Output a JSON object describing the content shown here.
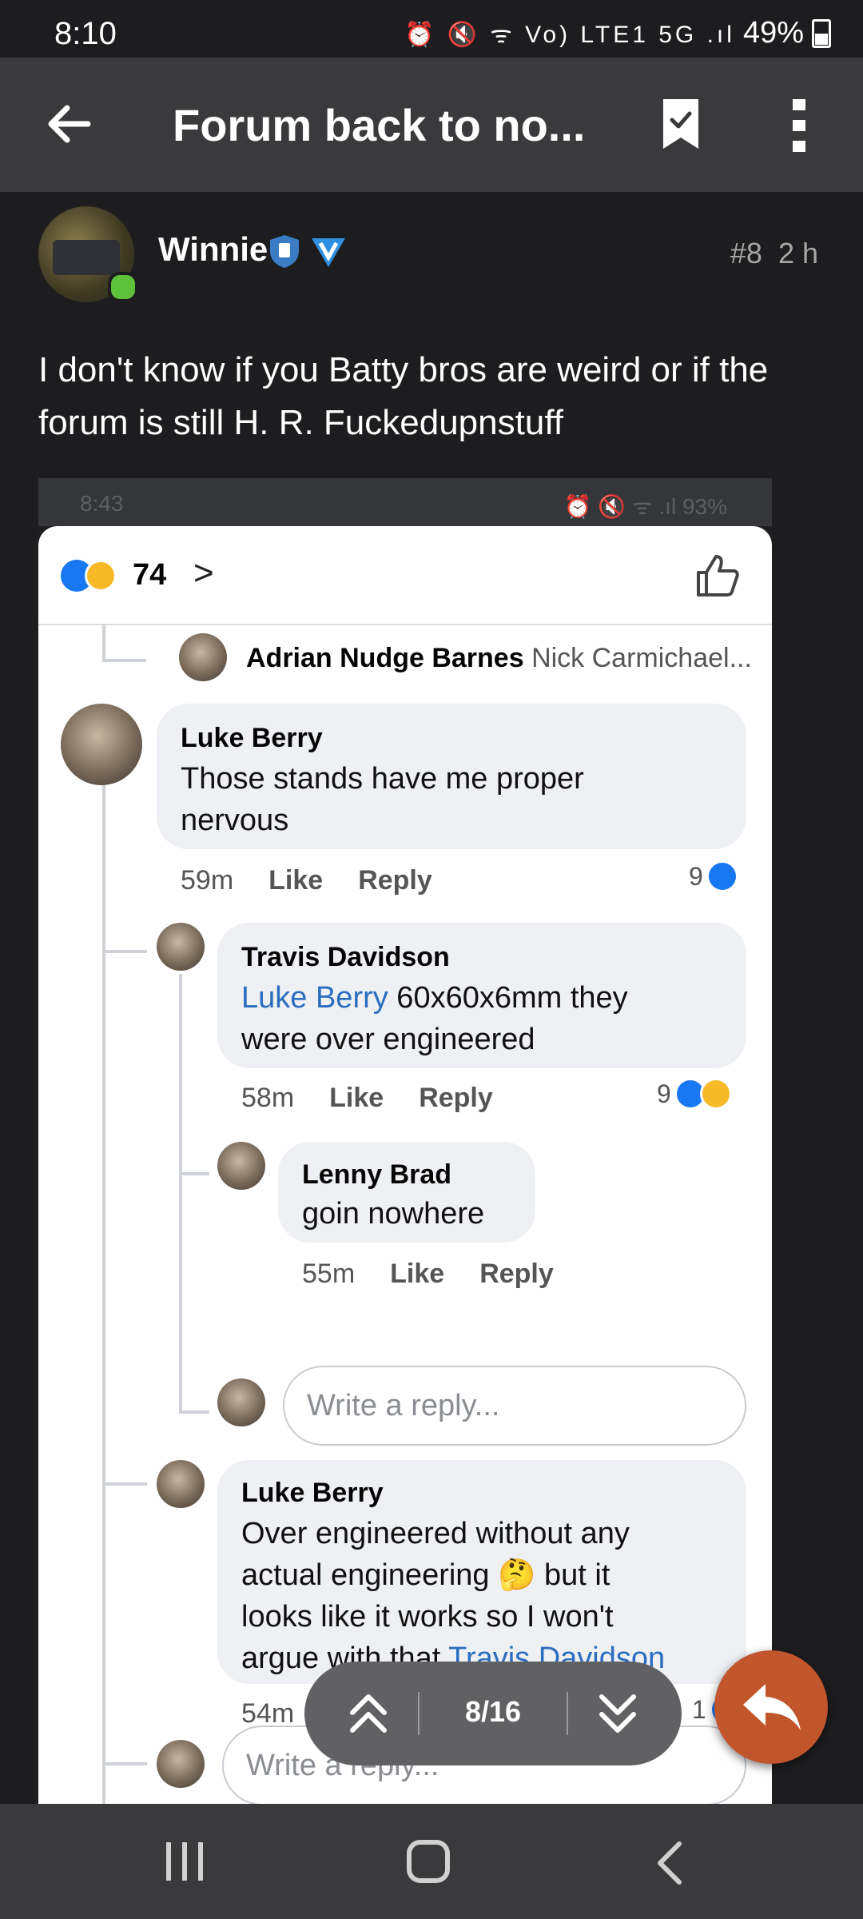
{
  "status_bar": {
    "time": "8:10",
    "icons": "⏰ 🔇 ᯤ Vo) LTE1 5G .ıl",
    "battery": "49%"
  },
  "app_bar": {
    "title": "Forum back to no..."
  },
  "post": {
    "author": "Winnie",
    "post_number": "#8",
    "age": "2 h",
    "text": "I don't know if you Batty bros are weird or if the forum is still H. R. Fuckedupnstuff"
  },
  "screenshot": {
    "status_time": "8:43",
    "status_right": "⏰ 🔇 ᯤ .ıl 93%",
    "reaction_count": "74",
    "reaction_chevron": ">",
    "top_row": {
      "name": "Adrian Nudge Barnes",
      "sub": "Nick Carmichael..."
    },
    "comments": [
      {
        "name": "Luke Berry",
        "text": "Those stands have me proper nervous",
        "time": "59m",
        "like": "Like",
        "reply": "Reply",
        "count": "9"
      },
      {
        "name": "Travis Davidson",
        "mention": "Luke Berry",
        "text": " 60x60x6mm  they were over engineered",
        "time": "58m",
        "like": "Like",
        "reply": "Reply",
        "count": "9"
      },
      {
        "name": "Lenny Brad",
        "text": "goin nowhere",
        "time": "55m",
        "like": "Like",
        "reply": "Reply"
      },
      {
        "name": "Luke Berry",
        "text": "Over engineered without any actual engineering 🤔 but it looks like it works so I won't argue with that ",
        "mention": "Travis Davidson",
        "time": "54m",
        "count": "1"
      }
    ],
    "reply_placeholder": "Write a reply...",
    "reply_placeholder_2": "Write a reply..."
  },
  "pager": {
    "text": "8/16"
  },
  "colors": {
    "accent": "#c1552c",
    "facebook_blue": "#1877f2",
    "mention": "#2b6ec0",
    "appbar": "#3a3a3c"
  }
}
